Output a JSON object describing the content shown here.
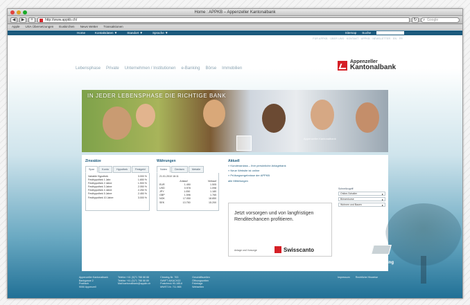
{
  "browser": {
    "title": "Home : APPKB – Appenzeller Kantonalbank",
    "url": "http://www.appkb.ch/",
    "search_placeholder": "Google",
    "bookmarks": [
      "Apple",
      "USA Übersetzungen",
      "Euskirchen",
      "News Wetter",
      "Transaktionen"
    ]
  },
  "site": {
    "topnav": [
      "Home",
      "Kontaktdaten ▼",
      "Standort ▼",
      "Sprache ▼"
    ],
    "topnav_right": [
      "Sitemap",
      "Suche"
    ],
    "subnav": "FÜR APPKB · ÜBER UNS · KONTAKT · APPKB · NEWSLETTER · EN · FR",
    "mainnav": [
      "Lebensphase",
      "Private",
      "Unternehmen / Institutionen",
      "e-Banking",
      "Börse",
      "Immobilien"
    ],
    "logo_line1": "Appenzeller",
    "logo_line2": "Kantonalbank"
  },
  "hero": {
    "title": "IN JEDER LEBENSPHASE DIE RICHTIGE BANK",
    "caption": "Appenzeller Kantonalbank"
  },
  "zinsen": {
    "heading": "Zinssätze",
    "tabs": [
      "Spar",
      "Konto",
      "Hypothek",
      "Festgeld"
    ],
    "rows": [
      {
        "label": "Variable Hypothek",
        "value": "3.000 %"
      },
      {
        "label": "Festhypothek 1 Jahr",
        "value": "1.650 %"
      },
      {
        "label": "Festhypothek 2 Jahre",
        "value": "1.900 %"
      },
      {
        "label": "Festhypothek 3 Jahre",
        "value": "2.050 %"
      },
      {
        "label": "Festhypothek 4 Jahre",
        "value": "2.250 %"
      },
      {
        "label": "Festhypothek 5 Jahre",
        "value": "2.450 %"
      },
      {
        "label": "Festhypothek 10 Jahre",
        "value": "3.000 %"
      }
    ]
  },
  "waehrungen": {
    "heading": "Währungen",
    "tabs": [
      "Noten",
      "Devisen",
      "Metalle"
    ],
    "date": "21.01.2010 16:11",
    "cols": [
      "",
      "Ankauf",
      "Verkauf"
    ],
    "rows": [
      {
        "ccy": "EUR",
        "buy": "1.450",
        "sell": "1.505"
      },
      {
        "ccy": "USD",
        "buy": "0.978",
        "sell": "1.098"
      },
      {
        "ccy": "JPY",
        "buy": "1.050",
        "sell": "1.180"
      },
      {
        "ccy": "GBP",
        "buy": "1.596",
        "sell": "1.765"
      },
      {
        "ccy": "NOK",
        "buy": "17.050",
        "sell": "18.850"
      },
      {
        "ccy": "SEK",
        "buy": "13.750",
        "sell": "15.200"
      }
    ]
  },
  "aktuell": {
    "heading": "Aktuell",
    "items": [
      "Kundenanlass – Ihre persönliche Anlagebank",
      "Neue Website ist online",
      "Prüfungsergebnisse der APPKB"
    ],
    "more": "alle Mitteilungen",
    "rss": "RSS"
  },
  "ad": {
    "text": "Jetzt vorsorgen und von langfristigen Renditechancen profitieren.",
    "small": "Anlage und Vorsorge",
    "brand": "Swisscanto"
  },
  "schnellzugriff": {
    "label": "Schnellzugriff",
    "options": [
      "Online-Schalter",
      "Börsenkurse",
      "Wohnen und Bauen"
    ]
  },
  "login": {
    "label": "Login e-Banking"
  },
  "footer": {
    "cols": [
      "Appenzeller Kantonalbank\nBankgasse 2\nPostfach\n9050 Appenzell",
      "Telefon  +41 (0)71 788 88 88\nTelefax  +41 (0)71 788 88 89\nMail     kantonalbank@appkb.ch",
      "Clearing-Nr.  763\nSWIFT  AIKACH22\nPostcheck  90-185-6\nMWST-Nr.  711 865",
      "Geschäftszeiten\nÖffnungszeiten\nFeiertage\nWebseiten"
    ],
    "links": [
      "Impressum",
      "Rechtliche Hinweise"
    ]
  }
}
